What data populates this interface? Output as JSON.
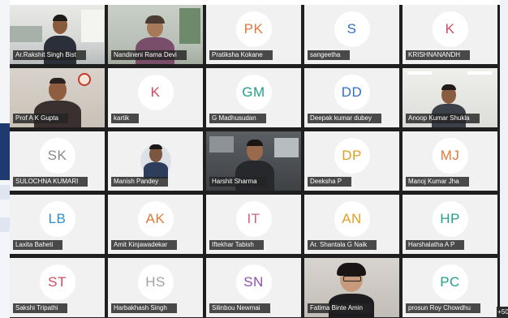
{
  "participants": [
    {
      "name": "Ar.Rakshit Singh Bist",
      "type": "video"
    },
    {
      "name": "Nandineni Rama Devi",
      "type": "video"
    },
    {
      "name": "Pratiksha Kokane",
      "initials": "PK",
      "color": "#e0793c"
    },
    {
      "name": "sangeetha",
      "initials": "S",
      "color": "#2f6fd1"
    },
    {
      "name": "KRISHNANANDH",
      "initials": "K",
      "color": "#d64b5a"
    },
    {
      "name": "Prof A K Gupta",
      "type": "video"
    },
    {
      "name": "kartik",
      "initials": "K",
      "color": "#d64b5a"
    },
    {
      "name": "G Madhusudan",
      "initials": "GM",
      "color": "#239e8c"
    },
    {
      "name": "Deepak kumar dubey",
      "initials": "DD",
      "color": "#2f6fd1"
    },
    {
      "name": "Anoop Kumar Shukla",
      "type": "video"
    },
    {
      "name": "SULOCHNA KUMARI",
      "initials": "SK",
      "color": "#8a8a8a"
    },
    {
      "name": "Manish Pandey",
      "type": "video"
    },
    {
      "name": "Harshit Sharma",
      "type": "video"
    },
    {
      "name": "Deeksha P",
      "initials": "DP",
      "color": "#e0a020"
    },
    {
      "name": "Manoj Kumar Jha",
      "initials": "MJ",
      "color": "#e0793c"
    },
    {
      "name": "Laxita Baheti",
      "initials": "LB",
      "color": "#2f8fd1"
    },
    {
      "name": "Amit Kinjawadekar",
      "initials": "AK",
      "color": "#e0793c"
    },
    {
      "name": "Iftekhar Tabish",
      "initials": "IT",
      "color": "#d6617a"
    },
    {
      "name": "Ar. Shantala G Naik",
      "initials": "AN",
      "color": "#e0a020"
    },
    {
      "name": "Harshalatha A P",
      "initials": "HP",
      "color": "#239e8c"
    },
    {
      "name": "Sakshi Tripathi",
      "initials": "ST",
      "color": "#d64b5a"
    },
    {
      "name": "Harbakhash Singh",
      "initials": "HS",
      "color": "#a0a0a0"
    },
    {
      "name": "Silinbou Newmai",
      "initials": "SN",
      "color": "#8a4fb8"
    },
    {
      "name": "Fatima Binte Amin",
      "type": "video"
    },
    {
      "name": "prosun Roy Chowdhu",
      "initials": "PC",
      "color": "#239e8c"
    }
  ],
  "overflow_count": "+50"
}
